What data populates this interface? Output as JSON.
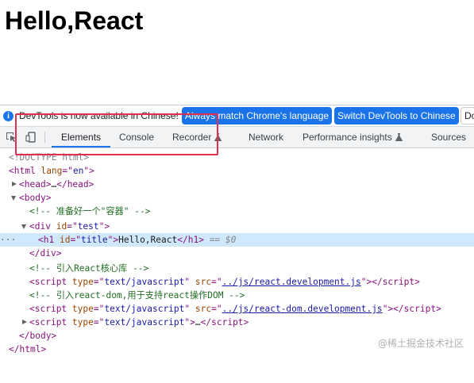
{
  "page": {
    "heading": "Hello,React"
  },
  "infobar": {
    "message": "DevTools is now available in Chinese!",
    "btn_match": "Always match Chrome's language",
    "btn_switch": "Switch DevTools to Chinese",
    "btn_dont": "Don't show again"
  },
  "tabs": {
    "elements": "Elements",
    "console": "Console",
    "recorder": "Recorder",
    "network": "Network",
    "performance_insights": "Performance insights",
    "sources": "Sources"
  },
  "dom": {
    "doctype": "<!DOCTYPE html>",
    "html_tag": "html",
    "lang_attr": "lang",
    "lang_val": "en",
    "head_tag": "head",
    "ellipsis": "…",
    "body_tag": "body",
    "comment_container": " 准备好一个\"容器\" ",
    "div_tag": "div",
    "id_attr": "id",
    "div_id": "test",
    "h1_tag": "h1",
    "h1_id": "title",
    "h1_text": "Hello,React",
    "selected_marker": "== $0",
    "comment_core": " 引入React核心库 ",
    "script_tag": "script",
    "type_attr": "type",
    "type_val": "text/javascript",
    "src_attr": "src",
    "src_react": "../js/react.development.js",
    "comment_dom": " 引入react-dom,用于支持react操作DOM ",
    "src_react_dom": "../js/react-dom.development.js"
  },
  "watermark": "@稀土掘金技术社区",
  "colors": {
    "accent": "#1a73e8",
    "highlight_box": "#e0304f",
    "selected_row": "#cfe8fc",
    "tag": "#881280",
    "attr_name": "#994500",
    "attr_value": "#1a1aa6",
    "comment": "#236e25"
  }
}
